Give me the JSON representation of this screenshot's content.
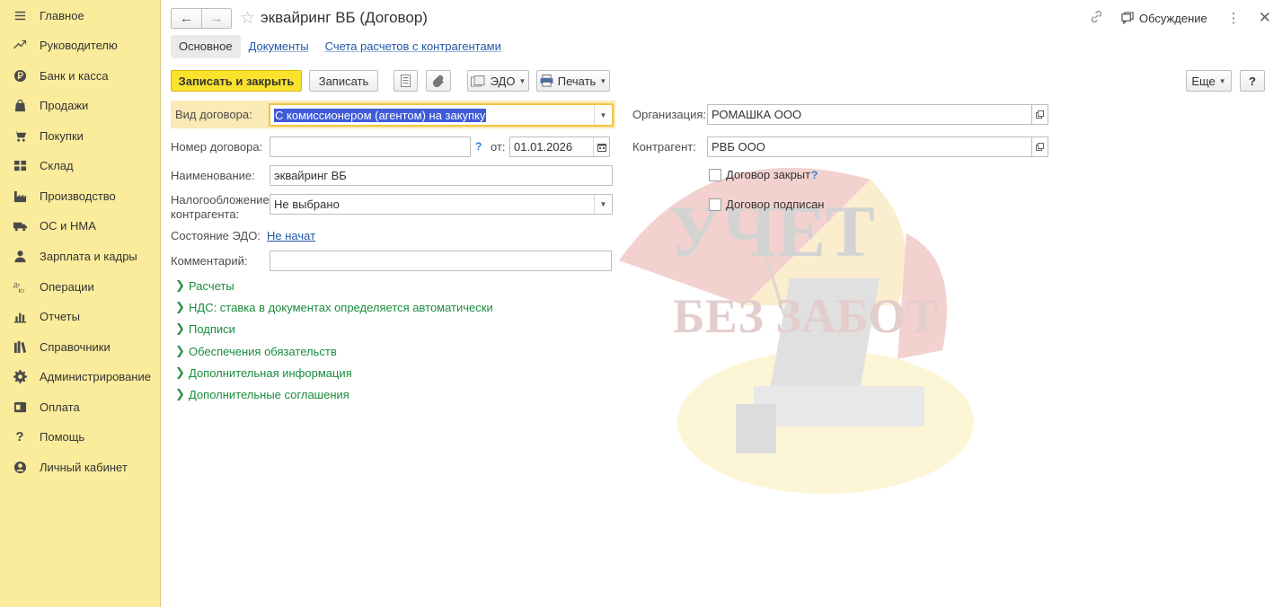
{
  "sidebar": {
    "items": [
      {
        "label": "Главное",
        "icon": "menu-icon"
      },
      {
        "label": "Руководителю",
        "icon": "trend-icon"
      },
      {
        "label": "Банк и касса",
        "icon": "ruble-icon"
      },
      {
        "label": "Продажи",
        "icon": "bag-icon"
      },
      {
        "label": "Покупки",
        "icon": "cart-icon"
      },
      {
        "label": "Склад",
        "icon": "warehouse-icon"
      },
      {
        "label": "Производство",
        "icon": "factory-icon"
      },
      {
        "label": "ОС и НМА",
        "icon": "truck-icon"
      },
      {
        "label": "Зарплата и кадры",
        "icon": "person-icon"
      },
      {
        "label": "Операции",
        "icon": "operations-icon"
      },
      {
        "label": "Отчеты",
        "icon": "chart-icon"
      },
      {
        "label": "Справочники",
        "icon": "books-icon"
      },
      {
        "label": "Администрирование",
        "icon": "gear-icon"
      },
      {
        "label": "Оплата",
        "icon": "payment-icon"
      },
      {
        "label": "Помощь",
        "icon": "question-icon"
      },
      {
        "label": "Личный кабинет",
        "icon": "user-circle-icon"
      }
    ]
  },
  "header": {
    "title": "эквайринг ВБ (Договор)",
    "discussion": "Обсуждение"
  },
  "tabs": [
    {
      "label": "Основное",
      "active": true
    },
    {
      "label": "Документы",
      "active": false
    },
    {
      "label": "Счета расчетов с контрагентами",
      "active": false
    }
  ],
  "toolbar": {
    "save_close": "Записать и закрыть",
    "save": "Записать",
    "edo": "ЭДО",
    "print": "Печать",
    "more": "Еще",
    "help": "?"
  },
  "form": {
    "vid_label": "Вид договора:",
    "vid_value": "С комиссионером (агентом) на закупку",
    "nomer_label": "Номер договора:",
    "nomer_value": "",
    "ot_label": "от:",
    "date_value": "01.01.2026",
    "naim_label": "Наименование:",
    "naim_value": "эквайринг ВБ",
    "nalog_label_1": "Налогообложение",
    "nalog_label_2": "контрагента:",
    "nalog_value": "Не выбрано",
    "edo_state_label": "Состояние ЭДО:",
    "edo_state_value": "Не начат",
    "comment_label": "Комментарий:",
    "comment_value": "",
    "org_label": "Организация:",
    "org_value": "РОМАШКА ООО",
    "kontr_label": "Контрагент:",
    "kontr_value": "РВБ ООО",
    "closed_label": "Договор закрыт",
    "closed_checked": false,
    "signed_label": "Договор подписан",
    "signed_checked": false
  },
  "groups": [
    "Расчеты",
    "НДС: ставка в документах определяется автоматически",
    "Подписи",
    "Обеспечения обязательств",
    "Дополнительная информация",
    "Дополнительные соглашения"
  ],
  "watermark": {
    "line1": "УЧЕТ",
    "line2": "БЕЗ ЗАБОТ"
  },
  "colors": {
    "sidebar_bg": "#fbec9c",
    "primary_btn": "#fbe22c",
    "link": "#2258a5",
    "group_green": "#1a8c3d",
    "selection": "#3f5bd9"
  }
}
